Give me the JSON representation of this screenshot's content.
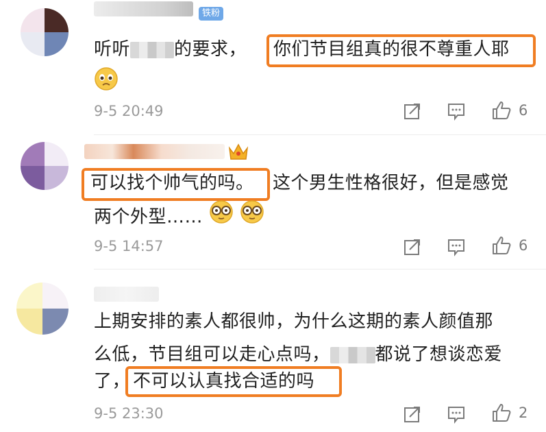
{
  "comments": [
    {
      "text_before": "听听",
      "text_after": "的要求，",
      "highlight": "你们节目组真的很不尊重人耶",
      "badge": "铁粉",
      "emoji": "pleading-face",
      "time": "9-5 20:49",
      "likes": "6"
    },
    {
      "highlight": "可以找个帅气的吗。",
      "text_after": "这个男生性格很好，但是感觉",
      "text_line2": "两个外型……",
      "emoji": "nerd-glasses-face",
      "time": "9-5 14:57",
      "likes": "6"
    },
    {
      "line1": "上期安排的素人都很帅，为什么这期的素人颜值那",
      "line2_before": "么低，节目组可以走心点吗，",
      "line2_after": "都说了想谈恋爱",
      "line3_before": "了，",
      "highlight": "不可以认真找合适的吗",
      "time": "9-5 23:30",
      "likes": "2"
    }
  ],
  "colors": {
    "highlight_border": "#f07d22",
    "muted_text": "#9a9a9a",
    "badge": "#6fa8e8"
  },
  "icons": [
    "share-icon",
    "comment-icon",
    "like-thumb-icon",
    "crown-icon"
  ]
}
